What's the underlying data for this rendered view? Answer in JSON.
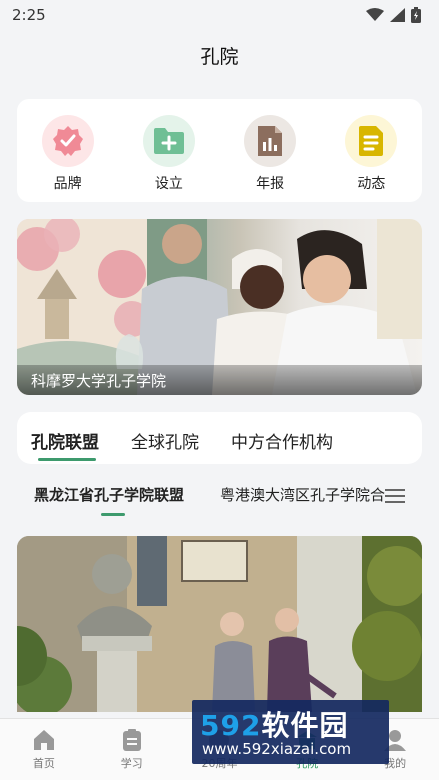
{
  "status_bar": {
    "time": "2:25"
  },
  "header": {
    "title": "孔院"
  },
  "quick_links": [
    {
      "label": "品牌",
      "icon": "badge-check-icon",
      "color": "#f08a96"
    },
    {
      "label": "设立",
      "icon": "folder-add-icon",
      "color": "#6fbf95"
    },
    {
      "label": "年报",
      "icon": "report-icon",
      "color": "#8c6e5e"
    },
    {
      "label": "动态",
      "icon": "document-icon",
      "color": "#d8b600"
    }
  ],
  "banner": {
    "caption": "科摩罗大学孔子学院"
  },
  "tabs": [
    {
      "label": "孔院联盟",
      "active": true
    },
    {
      "label": "全球孔院",
      "active": false
    },
    {
      "label": "中方合作机构",
      "active": false
    }
  ],
  "subtabs": [
    {
      "label": "黑龙江省孔子学院联盟",
      "active": true
    },
    {
      "label": "粤港澳大湾区孔子学院合",
      "active": false
    }
  ],
  "bottom_nav": [
    {
      "label": "首页",
      "icon": "home-icon",
      "active": false
    },
    {
      "label": "学习",
      "icon": "clipboard-icon",
      "active": false
    },
    {
      "label": "20周年",
      "icon": "anniversary-icon",
      "active": false
    },
    {
      "label": "孔院",
      "icon": "institute-icon",
      "active": true
    },
    {
      "label": "我的",
      "icon": "user-icon",
      "active": false
    }
  ],
  "watermark": {
    "brand_digits": "592",
    "brand_text": "软件园",
    "url": "www.592xiazai.com"
  },
  "colors": {
    "accent": "#3d9a6d",
    "background": "#f3f4f6"
  }
}
